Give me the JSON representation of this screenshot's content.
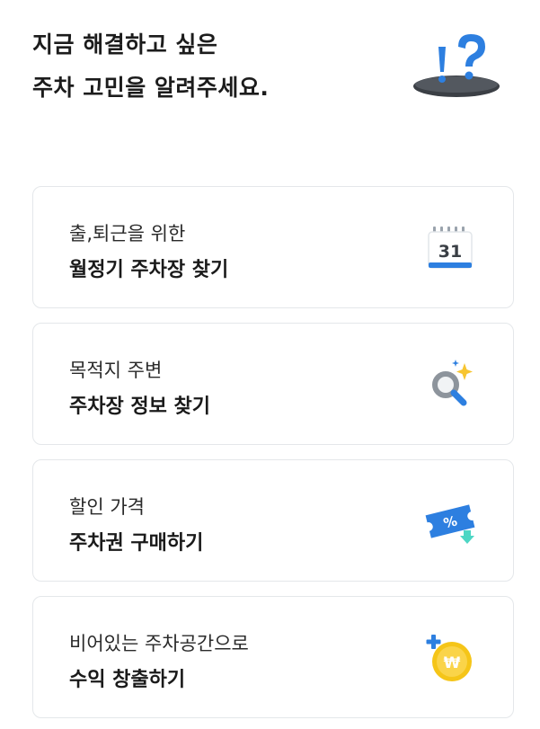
{
  "header": {
    "line1": "지금 해결하고 싶은",
    "line2": "주차 고민을 알려주세요."
  },
  "cards": [
    {
      "sub": "출,퇴근을 위한",
      "main": "월정기 주차장 찾기",
      "icon": "calendar-icon",
      "icon_text": "31"
    },
    {
      "sub": "목적지 주변",
      "main": "주차장 정보 찾기",
      "icon": "magnifier-sparkle-icon"
    },
    {
      "sub": "할인 가격",
      "main": "주차권 구매하기",
      "icon": "discount-ticket-icon",
      "icon_text": "%"
    },
    {
      "sub": "비어있는 주차공간으로",
      "main": "수익 창출하기",
      "icon": "won-coin-icon",
      "icon_text": "₩"
    }
  ],
  "colors": {
    "accent_blue": "#2d7fe0",
    "coin_yellow": "#f5c518",
    "sparkle_yellow": "#f7c531",
    "card_border": "#e4e7ea"
  }
}
